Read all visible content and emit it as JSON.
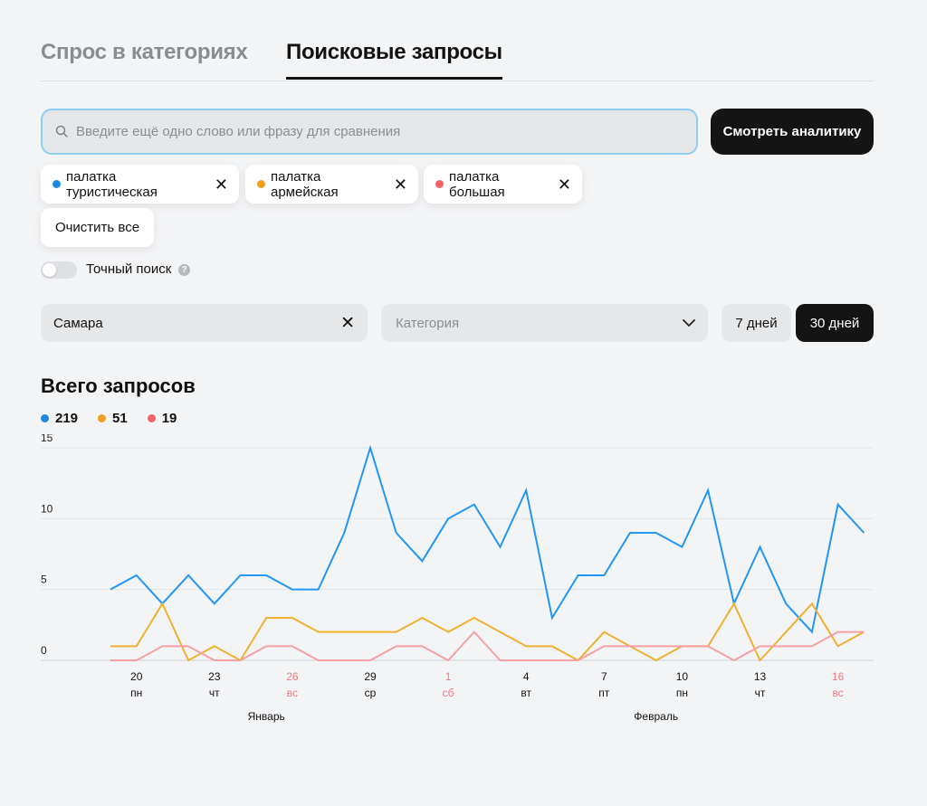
{
  "tabs": [
    {
      "label": "Спрос в категориях",
      "active": false
    },
    {
      "label": "Поисковые запросы",
      "active": true
    }
  ],
  "search": {
    "placeholder": "Введите ещё одно слово или фразу для сравнения",
    "button_label": "Смотреть аналитику"
  },
  "chips": [
    {
      "label": "палатка туристическая",
      "color": "#1e88e5"
    },
    {
      "label": "палатка армейская",
      "color": "#f0a020"
    },
    {
      "label": "палатка большая",
      "color": "#f06468"
    }
  ],
  "clear_label": "Очистить все",
  "exact_search": {
    "label": "Точный поиск",
    "enabled": false
  },
  "filters": {
    "city": "Самара",
    "category_placeholder": "Категория",
    "period_7": "7 дней",
    "period_30": "30 дней",
    "active_period": "30 дней"
  },
  "chart_title": "Всего запросов",
  "totals": [
    {
      "value": "219",
      "color": "#1e88e5"
    },
    {
      "value": "51",
      "color": "#f0a020"
    },
    {
      "value": "19",
      "color": "#f06468"
    }
  ],
  "chart_data": {
    "type": "line",
    "ylim": [
      0,
      15
    ],
    "yticks": [
      0,
      5,
      10,
      15
    ],
    "grid": true,
    "x_days": 29,
    "x_tick_labels": [
      {
        "index": 1,
        "day": "20",
        "weekday": "пн",
        "weekend": false
      },
      {
        "index": 4,
        "day": "23",
        "weekday": "чт",
        "weekend": false
      },
      {
        "index": 7,
        "day": "26",
        "weekday": "вс",
        "weekend": true
      },
      {
        "index": 10,
        "day": "29",
        "weekday": "ср",
        "weekend": false
      },
      {
        "index": 13,
        "day": "1",
        "weekday": "сб",
        "weekend": true
      },
      {
        "index": 16,
        "day": "4",
        "weekday": "вт",
        "weekend": false
      },
      {
        "index": 19,
        "day": "7",
        "weekday": "пт",
        "weekend": false
      },
      {
        "index": 22,
        "day": "10",
        "weekday": "пн",
        "weekend": false
      },
      {
        "index": 25,
        "day": "13",
        "weekday": "чт",
        "weekend": false
      },
      {
        "index": 28,
        "day": "16",
        "weekday": "вс",
        "weekend": true
      }
    ],
    "months": [
      {
        "label": "Январь",
        "index": 6
      },
      {
        "label": "Февраль",
        "index": 21
      }
    ],
    "series": [
      {
        "color": "#2196f3",
        "values": [
          5,
          6,
          4,
          6,
          4,
          6,
          6,
          5,
          5,
          9,
          15,
          9,
          7,
          10,
          11,
          8,
          12,
          3,
          6,
          6,
          9,
          9,
          8,
          12,
          4,
          8,
          4,
          2,
          11,
          9
        ]
      },
      {
        "color": "#f0b030",
        "values": [
          1,
          1,
          4,
          0,
          1,
          0,
          3,
          3,
          2,
          2,
          2,
          2,
          3,
          2,
          3,
          2,
          1,
          1,
          0,
          2,
          1,
          0,
          1,
          1,
          4,
          0,
          2,
          4,
          1,
          2
        ]
      },
      {
        "color": "#f4a0a4",
        "values": [
          0,
          0,
          1,
          1,
          0,
          0,
          1,
          1,
          0,
          0,
          0,
          1,
          1,
          0,
          2,
          0,
          0,
          0,
          0,
          1,
          1,
          1,
          1,
          1,
          0,
          1,
          1,
          1,
          2,
          2
        ]
      }
    ],
    "weekend_color": "#f07a80"
  }
}
